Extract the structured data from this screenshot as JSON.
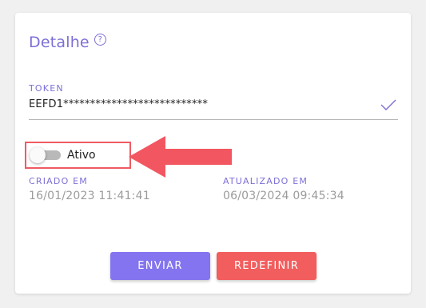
{
  "card": {
    "title": "Detalhe",
    "help_icon": "question-circle-icon"
  },
  "token": {
    "label": "TOKEN",
    "value": "EEFD1***************************",
    "status_icon": "check-icon"
  },
  "status_toggle": {
    "label": "Ativo",
    "checked": false
  },
  "meta": {
    "created_label": "CRIADO EM",
    "created_value": "16/01/2023 11:41:41",
    "updated_label": "ATUALIZADO EM",
    "updated_value": "06/03/2024 09:45:34"
  },
  "actions": {
    "send_label": "ENVIAR",
    "reset_label": "REDEFINIR"
  },
  "colors": {
    "accent": "#7c6fd6",
    "send_button": "#8474ef",
    "reset_button": "#f25d5d",
    "highlight": "#ef5b63"
  }
}
